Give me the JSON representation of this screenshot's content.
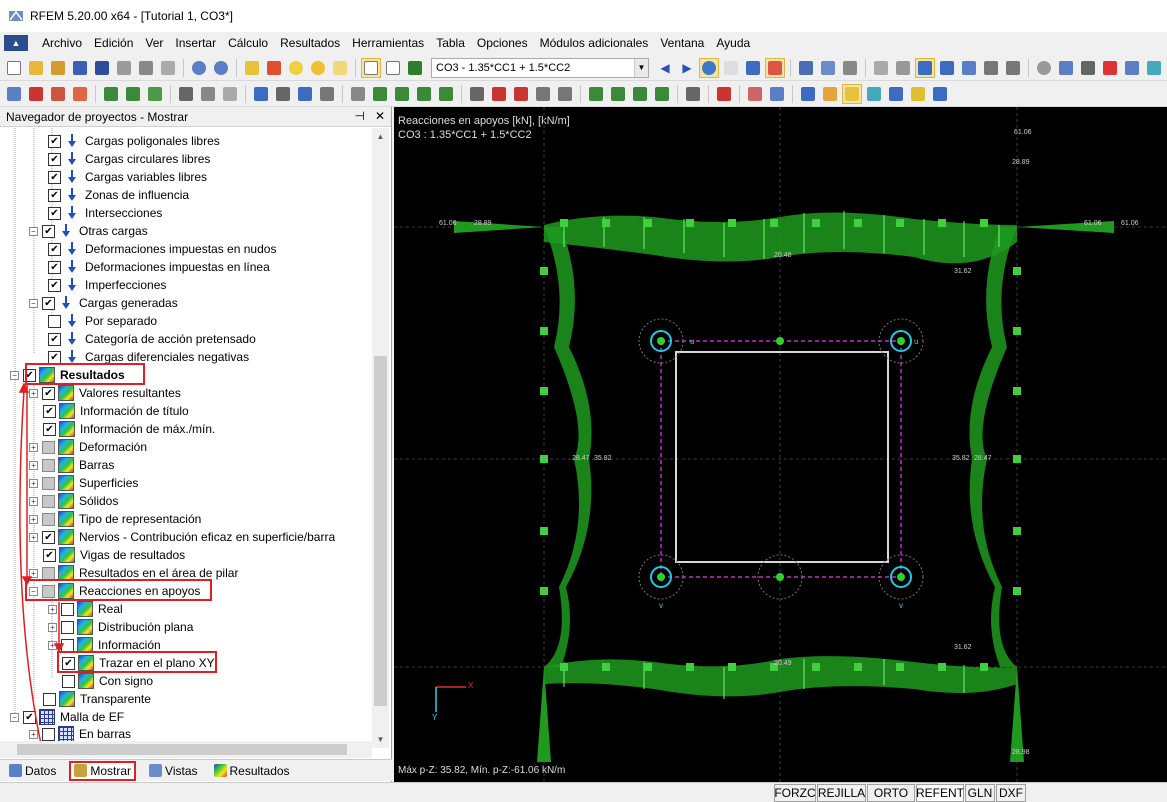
{
  "window": {
    "title": "RFEM 5.20.00 x64 - [Tutorial 1, CO3*]"
  },
  "menu": [
    "Archivo",
    "Edición",
    "Ver",
    "Insertar",
    "Cálculo",
    "Resultados",
    "Herramientas",
    "Tabla",
    "Opciones",
    "Módulos adicionales",
    "Ventana",
    "Ayuda"
  ],
  "toolbar": {
    "load_combo_value": "CO3 - 1.35*CC1 + 1.5*CC2"
  },
  "navigator": {
    "title": "Navegador de proyectos - Mostrar",
    "items": [
      {
        "label": "Cargas poligonales libres"
      },
      {
        "label": "Cargas circulares libres"
      },
      {
        "label": "Cargas variables libres"
      },
      {
        "label": "Zonas de influencia"
      },
      {
        "label": "Intersecciones"
      },
      {
        "label": "Otras cargas"
      },
      {
        "label": "Deformaciones impuestas en nudos"
      },
      {
        "label": "Deformaciones impuestas en línea"
      },
      {
        "label": "Imperfecciones"
      },
      {
        "label": "Cargas generadas"
      },
      {
        "label": "Por separado"
      },
      {
        "label": "Categoría de acción pretensado"
      },
      {
        "label": "Cargas diferenciales negativas"
      },
      {
        "label": "Resultados"
      },
      {
        "label": "Valores resultantes"
      },
      {
        "label": "Información de título"
      },
      {
        "label": "Información de máx./mín."
      },
      {
        "label": "Deformación"
      },
      {
        "label": "Barras"
      },
      {
        "label": "Superficies"
      },
      {
        "label": "Sólidos"
      },
      {
        "label": "Tipo de representación"
      },
      {
        "label": "Nervios - Contribución eficaz en superficie/barra"
      },
      {
        "label": "Vigas de resultados"
      },
      {
        "label": "Resultados en el área de pilar"
      },
      {
        "label": "Reacciones en apoyos"
      },
      {
        "label": "Real"
      },
      {
        "label": "Distribución plana"
      },
      {
        "label": "Información"
      },
      {
        "label": "Trazar en el plano XY"
      },
      {
        "label": "Con signo"
      },
      {
        "label": "Transparente"
      },
      {
        "label": "Malla de EF"
      },
      {
        "label": "En barras"
      }
    ],
    "tabs": [
      "Datos",
      "Mostrar",
      "Vistas",
      "Resultados"
    ]
  },
  "canvas": {
    "heading": "Reacciones en apoyos [kN], [kN/m]",
    "combo": "CO3 : 1.35*CC1 + 1.5*CC2",
    "footer": "Máx p-Z: 35.82, Mín. p-Z:-61.06 kN/m",
    "values": {
      "corner": "61.06",
      "edge_max": "35.82",
      "edge_side": "28.47",
      "mid_top": "20.48",
      "mid_bottom": "20.49",
      "side_right": "31.62",
      "side_right_lower": "31.62",
      "top_left": "28.89",
      "right_top": "28.89",
      "bottom_right": "28.98"
    },
    "axis": {
      "x_label": "X",
      "y_label": "Y",
      "u": "u",
      "v": "v"
    }
  },
  "status": [
    "FORZC",
    "REJILLA",
    "ORTO",
    "REFENT",
    "GLN",
    "DXF"
  ]
}
